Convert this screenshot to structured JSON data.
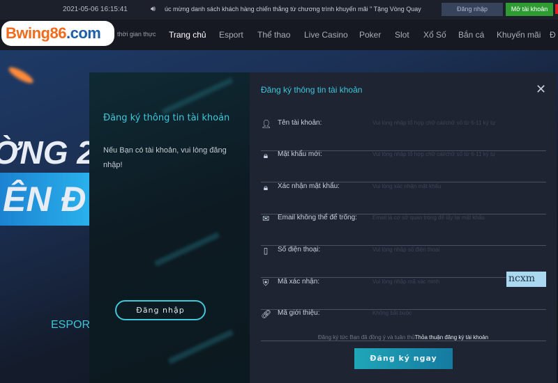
{
  "topbar": {
    "datetime": "2021-05-06 16:15:41",
    "marquee": "úc mừng danh sách khách hàng chiến thắng từ chương trình khuyến mãi \" Tặng Vòng Quay Mi",
    "login_label": "Đăng nhập",
    "open_account_label": "Mở tài khoản"
  },
  "nav": {
    "logo": "Bwing86.com",
    "realtime": "thời gian thực",
    "items": [
      "Trang chủ",
      "Esport",
      "Thể thao",
      "Live Casino",
      "Poker",
      "Slot",
      "Xổ Số",
      "Bắn cá",
      "Khuyến mãi",
      "Đ"
    ],
    "active": "Trang chủ"
  },
  "banner": {
    "line1": "ỜNG 2",
    "line2": "ÊN Đ",
    "esport": "ESPOR"
  },
  "left_panel": {
    "title": "Đăng ký thông tin tài khoản",
    "text": "Nếu Bạn có tài khoản, vui lòng đăng nhập!",
    "login_button": "Đăng nhập"
  },
  "form": {
    "title": "Đăng ký thông tin tài khoản",
    "fields": [
      {
        "icon": "user-icon",
        "label": "Tên tài khoản:",
        "placeholder": "Vui lòng nhập tổ hợp chữ cái/chữ số từ 6-11 ký tự"
      },
      {
        "icon": "lock-icon",
        "label": "Mật khẩu mới:",
        "placeholder": "Vui lòng nhập tổ hợp chữ cái/chữ số từ 6-11 ký tự"
      },
      {
        "icon": "lock-icon",
        "label": "Xác nhận mật khẩu:",
        "placeholder": "Vui lòng xác nhận mật khẩu"
      },
      {
        "icon": "mail-icon",
        "label": "Email không thể để trống:",
        "placeholder": "Email là cơ sở quan trọng để lấy lại mật khẩu"
      },
      {
        "icon": "phone-icon",
        "label": "Số điện thoại:",
        "placeholder": "Vui lòng nhập số điện thoại"
      },
      {
        "icon": "shield-icon",
        "label": "Mã xác nhận:",
        "placeholder": "Vui lòng nhập mã xác minh"
      },
      {
        "icon": "link-icon",
        "label": "Mã giới thiệu:",
        "placeholder": "Không bắt buộc"
      }
    ],
    "captcha": "ncxm",
    "agree_text": "Đăng ký tức Bạn đã đồng ý và tuân thủ",
    "agree_link": "Thỏa thuận đăng ký tài khoản",
    "submit": "Đăng ký ngay"
  }
}
